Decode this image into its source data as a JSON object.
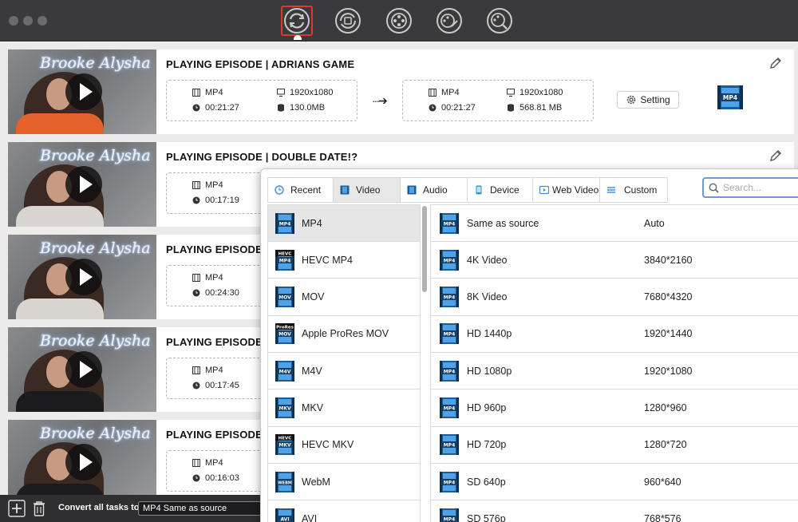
{
  "toolbar": {
    "tools": [
      {
        "name": "convert-tool",
        "icon": "convert-arrows-icon",
        "active": true
      },
      {
        "name": "enhance-tool",
        "icon": "rotate-clip-icon",
        "active": false
      },
      {
        "name": "compress-tool",
        "icon": "film-reel-icon",
        "active": false
      },
      {
        "name": "edit-tool",
        "icon": "film-edit-icon",
        "active": false
      },
      {
        "name": "gif-tool",
        "icon": "film-search-icon",
        "active": false
      }
    ]
  },
  "tasks": [
    {
      "title": "PLAYING EPISODE | ADRIANS GAME",
      "thumb_text": "Brooke Alysha",
      "src": {
        "format": "MP4",
        "resolution": "1920x1080",
        "duration": "00:21:27",
        "size": "130.0MB"
      },
      "dst": {
        "format": "MP4",
        "resolution": "1920x1080",
        "duration": "00:21:27",
        "size": "568.81 MB"
      },
      "setting_label": "Setting",
      "badge": "MP4"
    },
    {
      "title": "PLAYING EPISODE | DOUBLE DATE!?",
      "thumb_text": "Brooke Alysha",
      "src": {
        "format": "MP4",
        "duration": "00:17:19"
      }
    },
    {
      "title": "PLAYING EPISODE",
      "thumb_text": "Brooke Alysha",
      "src": {
        "format": "MP4",
        "duration": "00:24:30"
      }
    },
    {
      "title": "PLAYING EPISODE",
      "thumb_text": "Brooke Alysha",
      "src": {
        "format": "MP4",
        "duration": "00:17:45"
      }
    },
    {
      "title": "PLAYING EPISODE",
      "thumb_text": "Brooke Alysha",
      "src": {
        "format": "MP4",
        "duration": "00:16:03"
      }
    }
  ],
  "bottombar": {
    "convert_label": "Convert all tasks to",
    "convert_value": "MP4 Same as source"
  },
  "popup": {
    "tabs": [
      {
        "label": "Recent",
        "icon": "recent-clock-icon",
        "active": false
      },
      {
        "label": "Video",
        "icon": "video-film-icon",
        "active": true
      },
      {
        "label": "Audio",
        "icon": "audio-film-icon",
        "active": false
      },
      {
        "label": "Device",
        "icon": "phone-device-icon",
        "active": false
      },
      {
        "label": "Web Video",
        "icon": "web-video-icon",
        "active": false
      },
      {
        "label": "Custom",
        "icon": "custom-list-icon",
        "active": false
      }
    ],
    "search_placeholder": "Search...",
    "formats": [
      {
        "label": "MP4",
        "badge": "MP4",
        "top_badge": ""
      },
      {
        "label": "HEVC MP4",
        "badge": "MP4",
        "top_badge": "HEVC"
      },
      {
        "label": "MOV",
        "badge": "MOV",
        "top_badge": ""
      },
      {
        "label": "Apple ProRes MOV",
        "badge": "MOV",
        "top_badge": "ProRes"
      },
      {
        "label": "M4V",
        "badge": "M4V",
        "top_badge": ""
      },
      {
        "label": "MKV",
        "badge": "MKV",
        "top_badge": ""
      },
      {
        "label": "HEVC MKV",
        "badge": "MKV",
        "top_badge": "HEVC"
      },
      {
        "label": "WebM",
        "badge": "WEBM",
        "top_badge": ""
      },
      {
        "label": "AVI",
        "badge": "AVI",
        "top_badge": ""
      }
    ],
    "presets": [
      {
        "name": "Same as source",
        "resolution": "Auto"
      },
      {
        "name": "4K Video",
        "resolution": "3840*2160"
      },
      {
        "name": "8K Video",
        "resolution": "7680*4320"
      },
      {
        "name": "HD 1440p",
        "resolution": "1920*1440"
      },
      {
        "name": "HD 1080p",
        "resolution": "1920*1080"
      },
      {
        "name": "HD 960p",
        "resolution": "1280*960"
      },
      {
        "name": "HD 720p",
        "resolution": "1280*720"
      },
      {
        "name": "SD 640p",
        "resolution": "960*640"
      },
      {
        "name": "SD 576p",
        "resolution": "768*576"
      }
    ],
    "preset_badge": "MP4"
  },
  "colors": {
    "titlebar": "#3a3a3c",
    "active_tool_border": "#e2372c",
    "badge_blue": "#3f8fd8",
    "search_border": "#6b9ad8"
  }
}
